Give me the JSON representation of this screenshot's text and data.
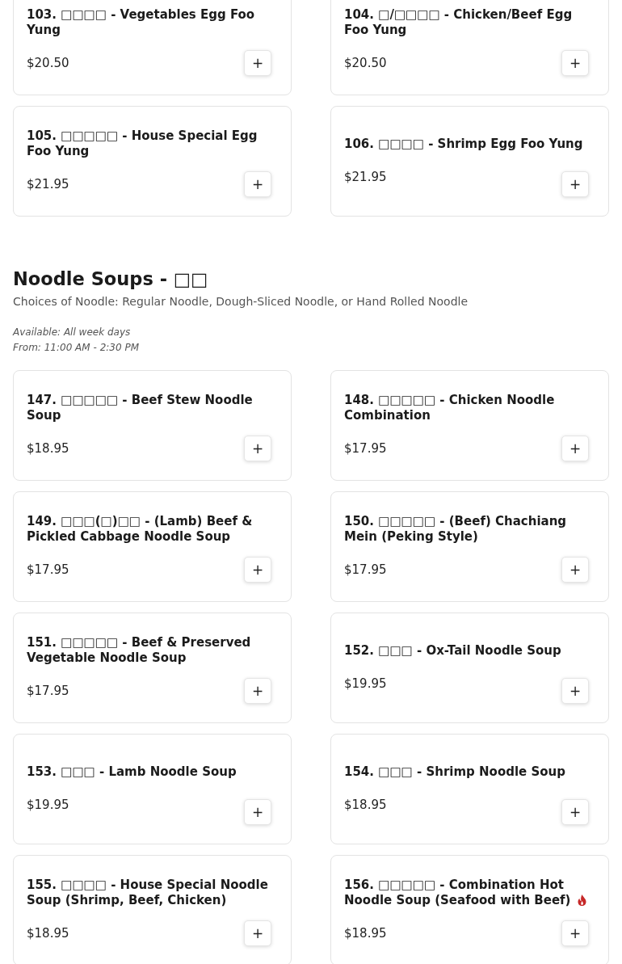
{
  "sections": [
    {
      "items": [
        {
          "name": "103. □□□□ - Vegetables Egg Foo Yung",
          "price": "$20.50",
          "spicy": false
        },
        {
          "name": "104. □/□□□□ - Chicken/Beef Egg Foo Yung",
          "price": "$20.50",
          "spicy": false
        },
        {
          "name": "105. □□□□□ - House Special Egg Foo Yung",
          "price": "$21.95",
          "spicy": false
        },
        {
          "name": "106. □□□□ - Shrimp Egg Foo Yung",
          "price": "$21.95",
          "spicy": false
        }
      ]
    },
    {
      "title": "Noodle Soups - □□",
      "description": "Choices of Noodle: Regular Noodle, Dough-Sliced Noodle, or Hand Rolled Noodle",
      "availability": [
        "Available: All week days",
        "From: 11:00 AM - 2:30 PM"
      ],
      "items": [
        {
          "name": "147. □□□□□ - Beef Stew Noodle Soup",
          "price": "$18.95",
          "spicy": false
        },
        {
          "name": "148. □□□□□ - Chicken Noodle Combination",
          "price": "$17.95",
          "spicy": false
        },
        {
          "name": "149. □□□(□)□□ - (Lamb) Beef & Pickled Cabbage Noodle Soup",
          "price": "$17.95",
          "spicy": false
        },
        {
          "name": "150. □□□□□ - (Beef) Chachiang Mein (Peking Style)",
          "price": "$17.95",
          "spicy": false
        },
        {
          "name": "151. □□□□□ - Beef & Preserved Vegetable Noodle Soup",
          "price": "$17.95",
          "spicy": false
        },
        {
          "name": "152. □□□ - Ox-Tail Noodle Soup",
          "price": "$19.95",
          "spicy": false
        },
        {
          "name": "153. □□□ - Lamb Noodle Soup",
          "price": "$19.95",
          "spicy": false
        },
        {
          "name": "154. □□□ - Shrimp Noodle Soup",
          "price": "$18.95",
          "spicy": false
        },
        {
          "name": "155. □□□□ - House Special Noodle Soup (Shrimp, Beef, Chicken)",
          "price": "$18.95",
          "spicy": false
        },
        {
          "name": "156. □□□□□ - Combination Hot Noodle Soup (Seafood with Beef)",
          "price": "$18.95",
          "spicy": true
        }
      ]
    }
  ],
  "add_button": "+"
}
